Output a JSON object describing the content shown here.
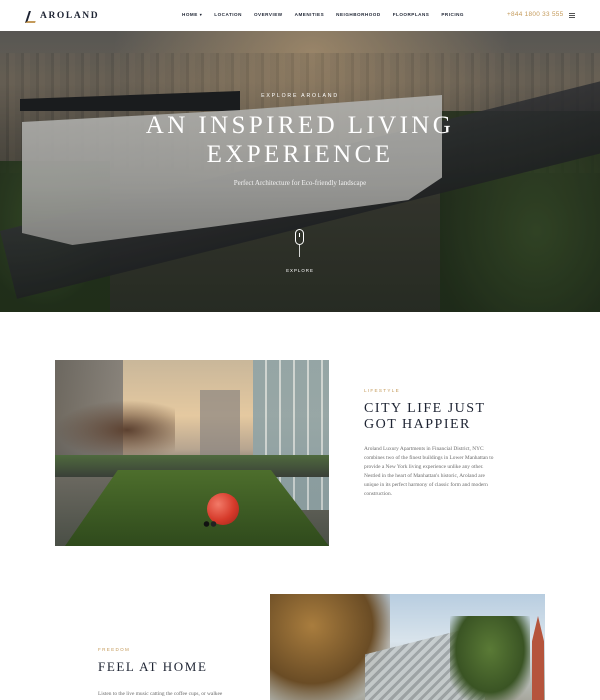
{
  "header": {
    "logo_text": "AROLAND",
    "nav": [
      {
        "label": "HOME",
        "has_dropdown": true
      },
      {
        "label": "LOCATION",
        "has_dropdown": false
      },
      {
        "label": "OVERVIEW",
        "has_dropdown": false
      },
      {
        "label": "AMENITIES",
        "has_dropdown": false
      },
      {
        "label": "NEIGHBORHOOD",
        "has_dropdown": false
      },
      {
        "label": "FLOORPLANS",
        "has_dropdown": false
      },
      {
        "label": "PRICING",
        "has_dropdown": false
      }
    ],
    "phone": "+844 1800 33 555",
    "menu_icon": "hamburger-icon"
  },
  "hero": {
    "kicker": "EXPLORE AROLAND",
    "title_line1": "AN INSPIRED LIVING",
    "title_line2": "EXPERIENCE",
    "subtitle": "Perfect Architecture for Eco-friendly landscape",
    "scroll_icon": "mouse-scroll-icon",
    "scroll_label": "EXPLORE"
  },
  "section_lifestyle": {
    "label": "LIFESTYLE",
    "title_line1": "CITY LIFE JUST",
    "title_line2": "GOT HAPPIER",
    "body": "Aroland Luxury Apartments in Financial District, NYC combines two of the finest buildings in Lower Manhattan to provide a New York living experience unlike any other. Nestled in the heart of Manhattan's historic, Aroland are unique in its perfect harmony of classic form and modern construction."
  },
  "section_freedom": {
    "label": "FREEDOM",
    "title": "FEEL AT HOME",
    "body": "Listen to the live music catting the coffee cups, or walkee"
  },
  "colors": {
    "accent": "#c49a5a",
    "heading": "#1e2433",
    "body_text": "#6b6b6b"
  }
}
